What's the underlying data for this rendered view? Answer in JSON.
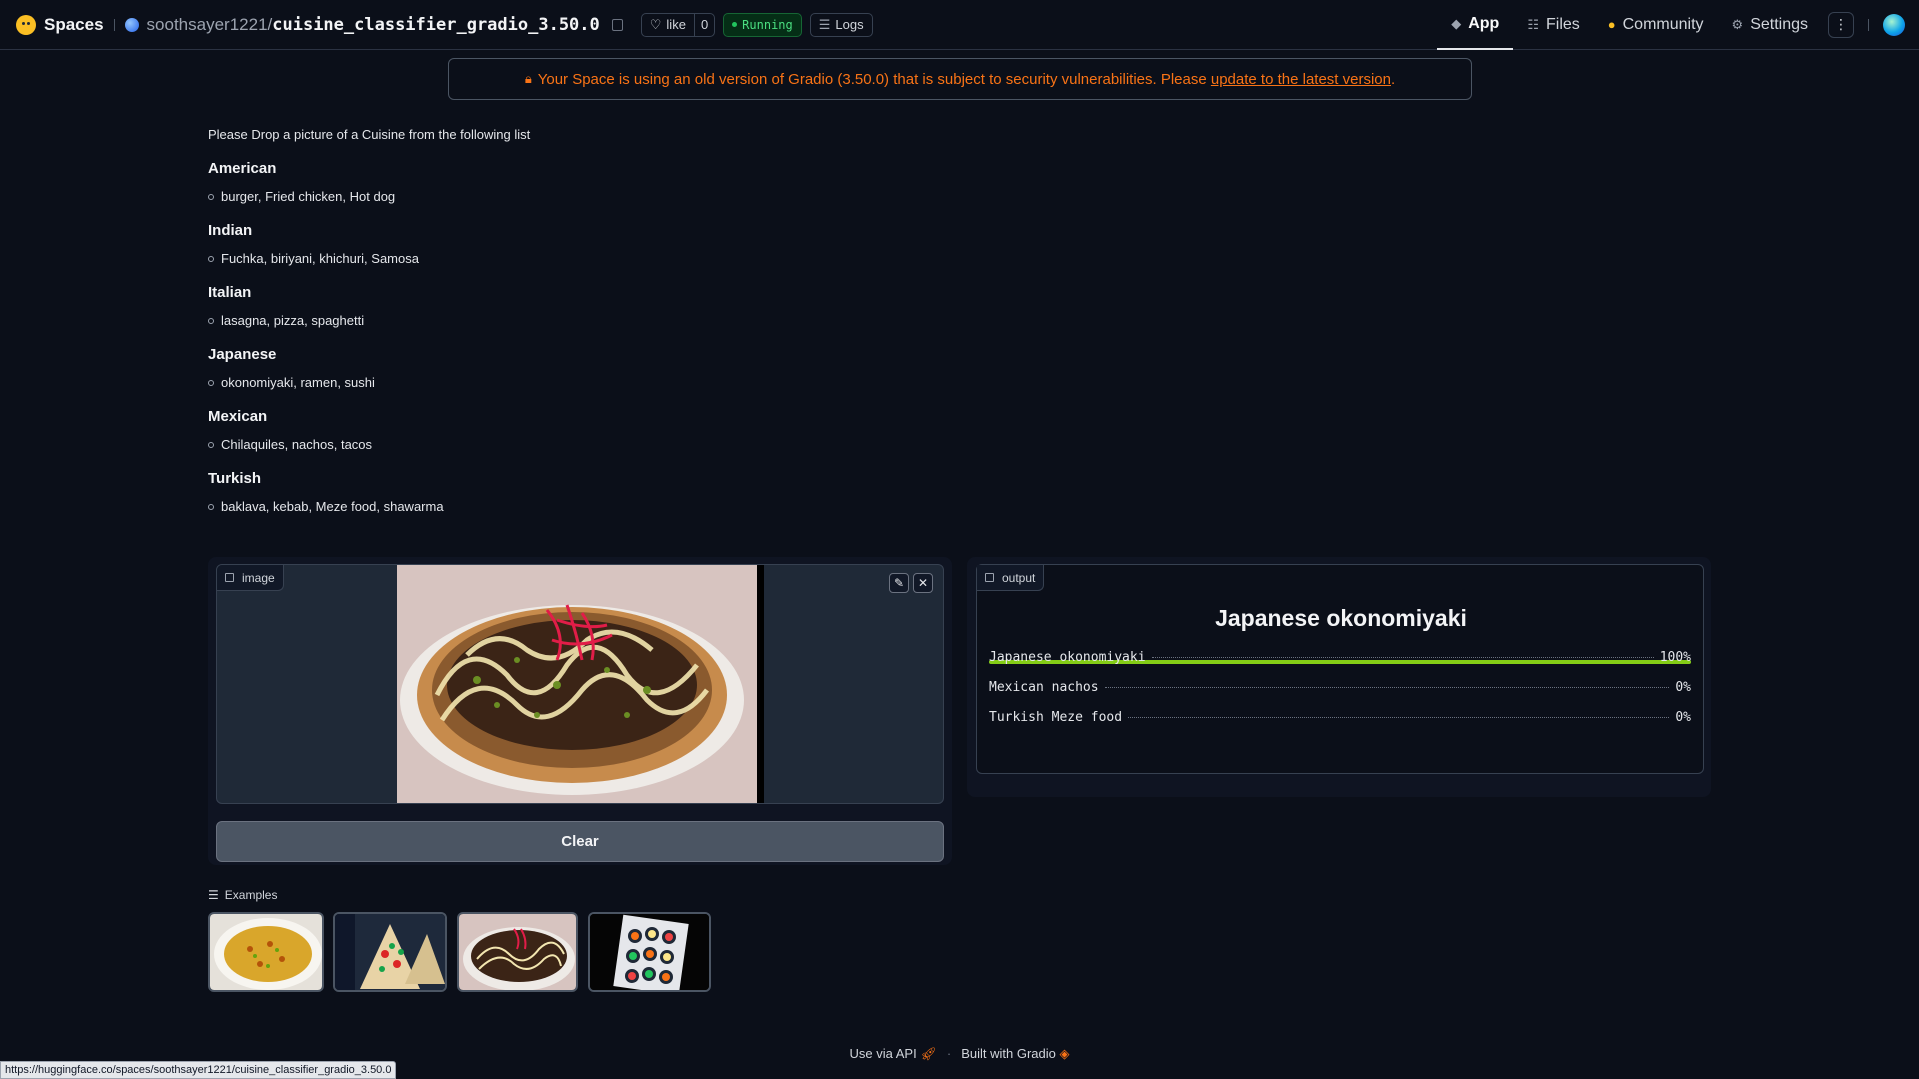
{
  "header": {
    "brand": "Spaces",
    "owner": "soothsayer1221/",
    "repo": "cuisine_classifier_gradio_3.50.0",
    "like_label": "like",
    "like_count": "0",
    "status": "Running",
    "logs_label": "Logs",
    "nav": {
      "app": "App",
      "files": "Files",
      "community": "Community",
      "settings": "Settings"
    }
  },
  "banner": {
    "text": "Your Space is using an old version of Gradio (3.50.0) that is subject to security vulnerabilities. Please ",
    "link": "update to the latest version",
    "end": "."
  },
  "intro": "Please Drop a picture of a Cuisine from the following list",
  "cuisines": [
    {
      "name": "American",
      "items": "burger, Fried chicken, Hot dog"
    },
    {
      "name": "Indian",
      "items": "Fuchka, biriyani, khichuri, Samosa"
    },
    {
      "name": "Italian",
      "items": "lasagna, pizza, spaghetti"
    },
    {
      "name": "Japanese",
      "items": "okonomiyaki, ramen, sushi"
    },
    {
      "name": "Mexican",
      "items": "Chilaquiles, nachos, tacos"
    },
    {
      "name": "Turkish",
      "items": "baklava, kebab, Meze food, shawarma"
    }
  ],
  "image_block": {
    "label": "image"
  },
  "clear_label": "Clear",
  "output": {
    "label": "output",
    "top_label": "Japanese okonomiyaki",
    "top_confidence": 1.0,
    "rows": [
      {
        "label": "Japanese okonomiyaki",
        "value": "100%"
      },
      {
        "label": "Mexican nachos",
        "value": "0%"
      },
      {
        "label": "Turkish Meze food",
        "value": "0%"
      }
    ]
  },
  "examples_label": "Examples",
  "footer": {
    "api": "Use via API",
    "built": "Built with Gradio"
  },
  "status_url": "https://huggingface.co/spaces/soothsayer1221/cuisine_classifier_gradio_3.50.0",
  "colors": {
    "background": "#0b0f19",
    "warning": "#f97316",
    "running": "#4ade80",
    "confidence": "#84cc16"
  }
}
